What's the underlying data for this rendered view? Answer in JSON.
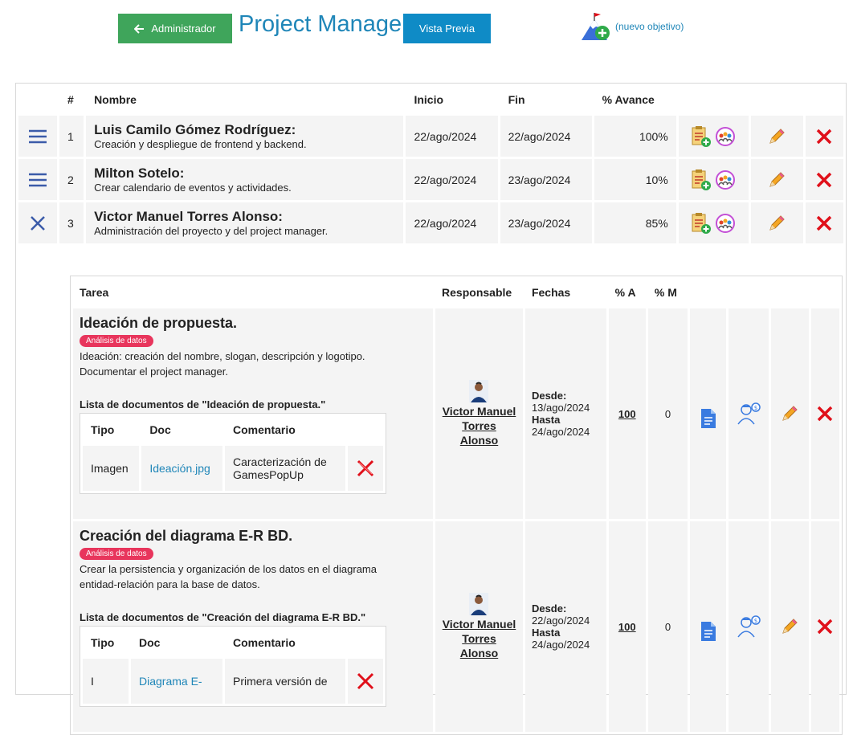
{
  "header": {
    "admin_button": "Administrador",
    "title": "Project Manager",
    "preview_button": "Vista Previa",
    "new_goal": "(nuevo objetivo)"
  },
  "members_table": {
    "headers": [
      "#",
      "Nombre",
      "Inicio",
      "Fin",
      "% Avance"
    ],
    "rows": [
      {
        "num": "1",
        "name": "Luis Camilo Gómez Rodríguez:",
        "desc": "Creación y despliegue de frontend y backend.",
        "start": "22/ago/2024",
        "end": "22/ago/2024",
        "progress": "100%",
        "toggle": "menu-icon"
      },
      {
        "num": "2",
        "name": "Milton Sotelo:",
        "desc": "Crear calendario de eventos y actividades.",
        "start": "22/ago/2024",
        "end": "23/ago/2024",
        "progress": "10%",
        "toggle": "menu-icon"
      },
      {
        "num": "3",
        "name": "Victor Manuel Torres Alonso:",
        "desc": "Administración del proyecto y del project manager.",
        "start": "22/ago/2024",
        "end": "23/ago/2024",
        "progress": "85%",
        "toggle": "close-icon"
      }
    ]
  },
  "tasks_table": {
    "headers": [
      "Tarea",
      "Responsable",
      "Fechas",
      "% A",
      "% M"
    ],
    "rows": [
      {
        "name": "Ideación de propuesta.",
        "tag": "Análisis de datos",
        "desc": "Ideación: creación del nombre, slogan, descripción y logotipo. Documentar el project manager.",
        "doclist_title": "Lista de documentos de \"Ideación de propuesta.\"",
        "doc_headers": [
          "Tipo",
          "Doc",
          "Comentario"
        ],
        "docs": [
          {
            "type": "Imagen",
            "doc": "Ideación.jpg",
            "comment": "Caracterización de GamesPopUp"
          }
        ],
        "responsible": "Victor Manuel Torres Alonso",
        "from_label": "Desde:",
        "from": "13/ago/2024",
        "to_label": "Hasta",
        "to": "24/ago/2024",
        "pa": "100",
        "pm": "0"
      },
      {
        "name": "Creación del diagrama E-R BD.",
        "tag": "Análisis de datos",
        "desc": "Crear la persistencia y organización de los datos en el diagrama entidad-relación para la base de datos.",
        "doclist_title": "Lista de documentos de \"Creación del diagrama E-R BD.\"",
        "doc_headers": [
          "Tipo",
          "Doc",
          "Comentario"
        ],
        "docs": [
          {
            "type": "I",
            "doc": "Diagrama E-",
            "comment": "Primera versión de"
          }
        ],
        "responsible": "Victor Manuel Torres Alonso",
        "from_label": "Desde:",
        "from": "22/ago/2024",
        "to_label": "Hasta",
        "to": "24/ago/2024",
        "pa": "100",
        "pm": "0"
      }
    ]
  },
  "colors": {
    "green": "#3fa55b",
    "blue": "#0f8bc6",
    "title": "#1f86b8",
    "badge": "#e8355c",
    "delete": "#e0101a"
  }
}
